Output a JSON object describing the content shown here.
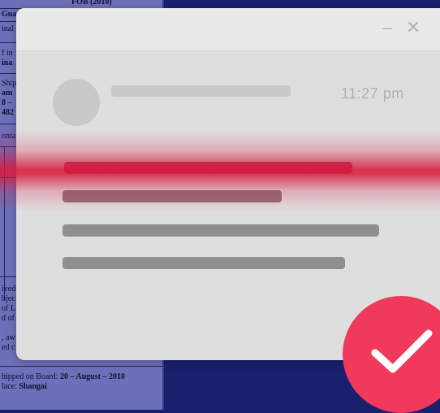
{
  "background_document": {
    "header": "FOB (2010)",
    "fragments": [
      "Gua",
      "inal",
      "f in",
      "ina",
      "Ship",
      "am",
      "8 –",
      "482",
      "onta",
      "ived",
      "bjec",
      "of L",
      "d of",
      ", aw",
      "ed c"
    ],
    "footer_shipped_prefix": "hipped on Board:",
    "footer_shipped_value": "20 – August – 2010",
    "footer_place_prefix": "lace:",
    "footer_place_value": "Shangai"
  },
  "window": {
    "minimize_glyph": "–",
    "close_glyph": "✕",
    "time": "11:27 pm"
  },
  "colors": {
    "window_bg": "#dedede",
    "scan_red": "#d7193c",
    "check_badge": "#f03a5c",
    "page_bg": "#1a1f6e"
  },
  "icons": {
    "check": "checkmark-icon",
    "close": "close-icon",
    "minimize": "minimize-icon"
  }
}
